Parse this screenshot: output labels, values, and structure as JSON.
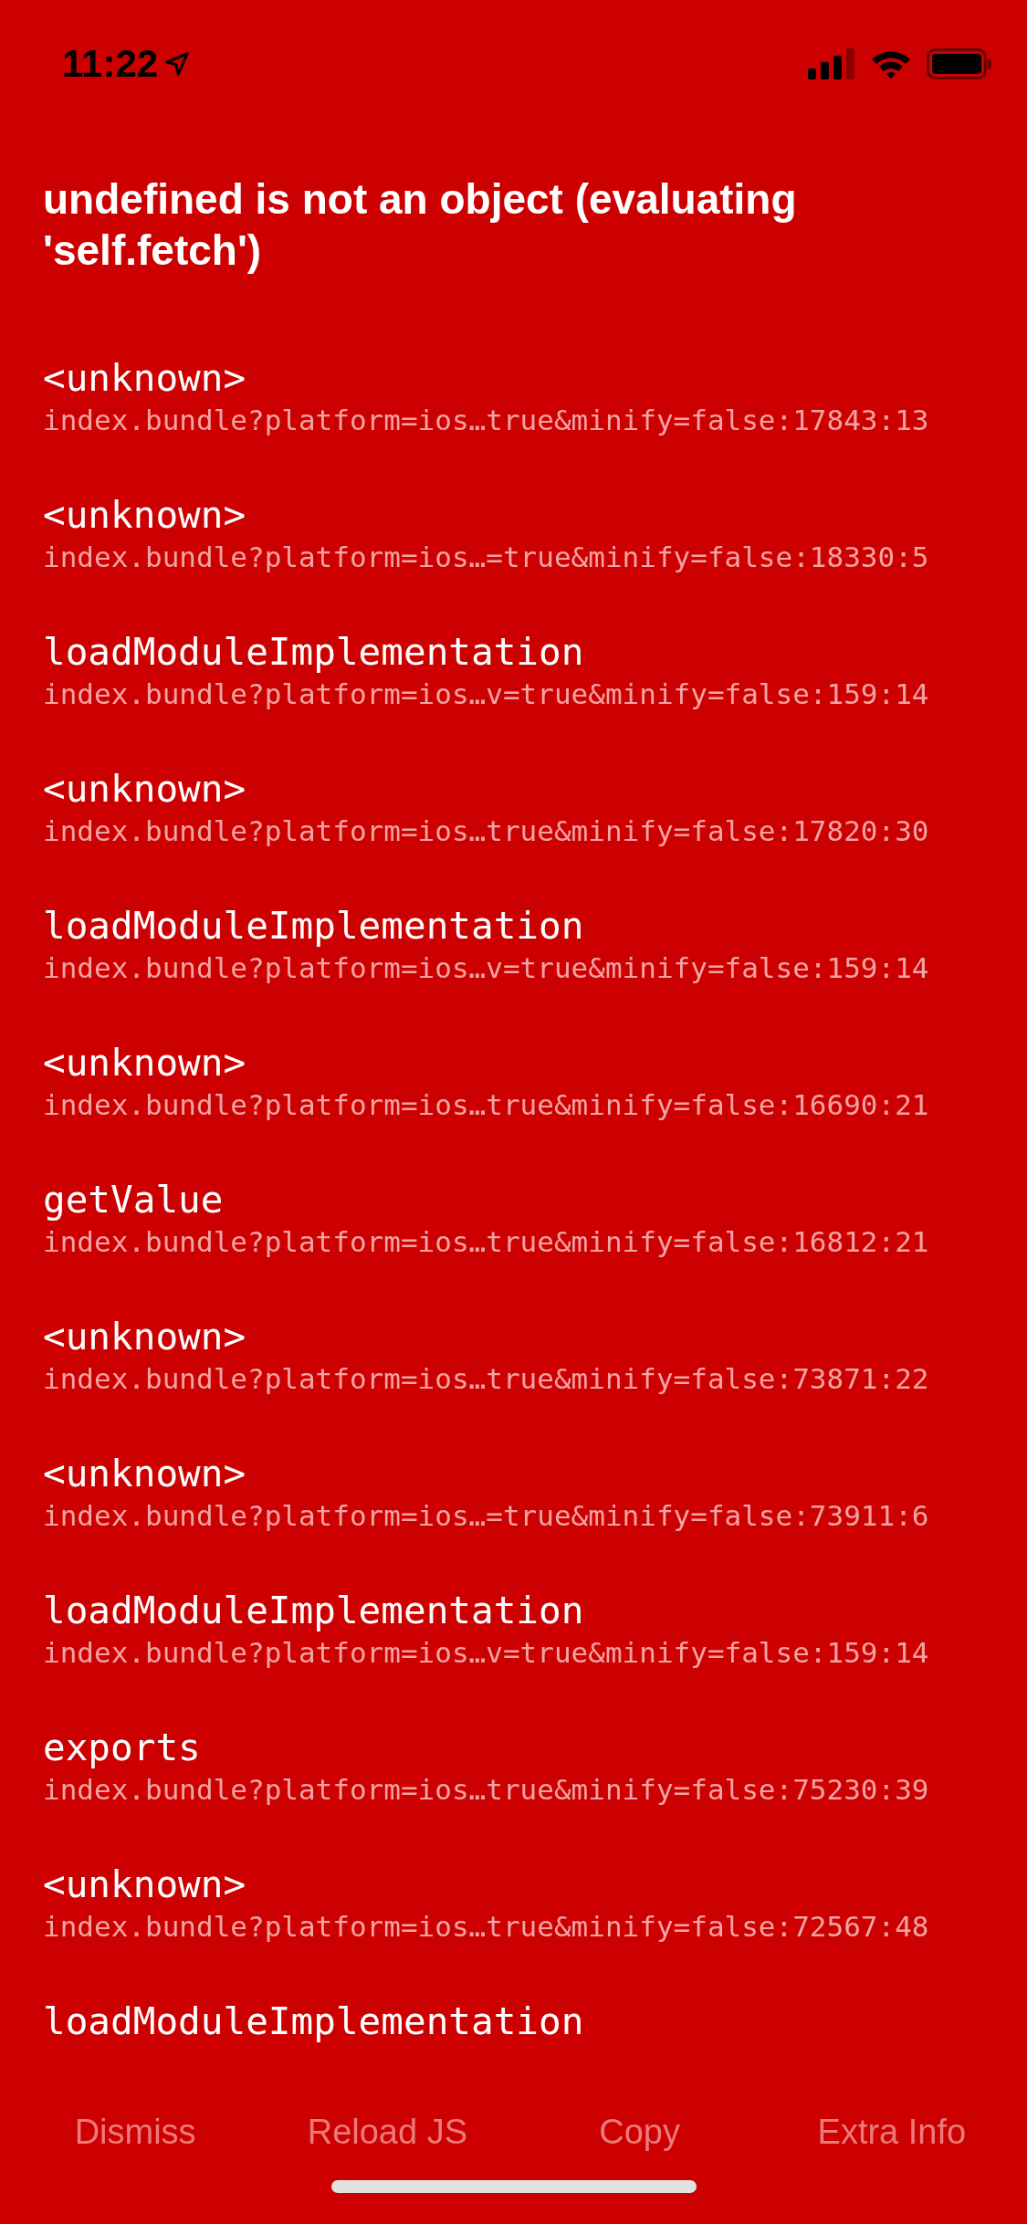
{
  "status_bar": {
    "time": "11:22"
  },
  "error": {
    "message": "undefined is not an object (evaluating 'self.fetch')"
  },
  "stack": [
    {
      "method": "<unknown>",
      "file": "index.bundle?platform=ios…true&minify=false:17843:13"
    },
    {
      "method": "<unknown>",
      "file": "index.bundle?platform=ios…=true&minify=false:18330:5"
    },
    {
      "method": "loadModuleImplementation",
      "file": "index.bundle?platform=ios…v=true&minify=false:159:14"
    },
    {
      "method": "<unknown>",
      "file": "index.bundle?platform=ios…true&minify=false:17820:30"
    },
    {
      "method": "loadModuleImplementation",
      "file": "index.bundle?platform=ios…v=true&minify=false:159:14"
    },
    {
      "method": "<unknown>",
      "file": "index.bundle?platform=ios…true&minify=false:16690:21"
    },
    {
      "method": "getValue",
      "file": "index.bundle?platform=ios…true&minify=false:16812:21"
    },
    {
      "method": "<unknown>",
      "file": "index.bundle?platform=ios…true&minify=false:73871:22"
    },
    {
      "method": "<unknown>",
      "file": "index.bundle?platform=ios…=true&minify=false:73911:6"
    },
    {
      "method": "loadModuleImplementation",
      "file": "index.bundle?platform=ios…v=true&minify=false:159:14"
    },
    {
      "method": "exports",
      "file": "index.bundle?platform=ios…true&minify=false:75230:39"
    },
    {
      "method": "<unknown>",
      "file": "index.bundle?platform=ios…true&minify=false:72567:48"
    },
    {
      "method": "loadModuleImplementation"
    }
  ],
  "buttons": [
    "Dismiss",
    "Reload JS",
    "Copy",
    "Extra Info"
  ]
}
